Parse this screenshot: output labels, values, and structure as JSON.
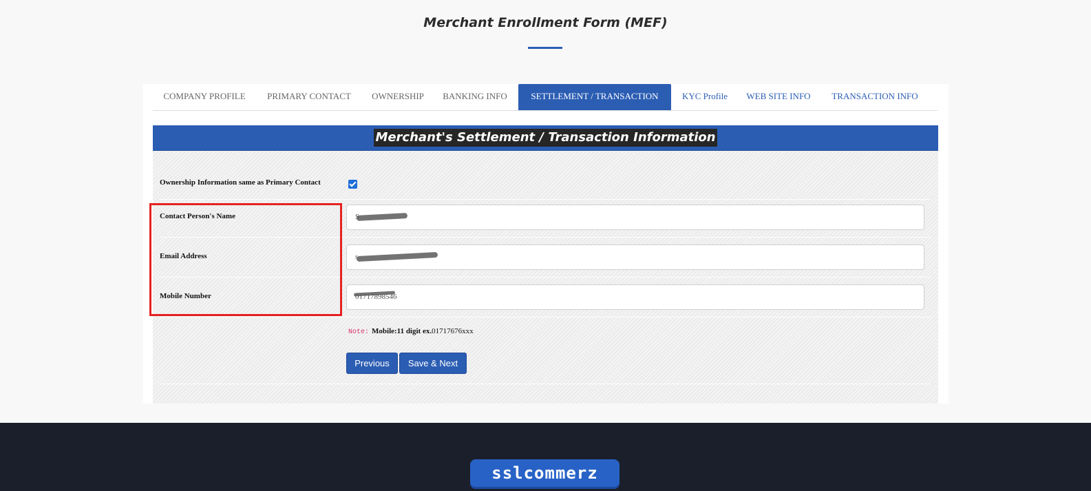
{
  "header": {
    "title": "Merchant Enrollment Form (MEF)"
  },
  "tabs": [
    {
      "label": "COMPANY PROFILE",
      "state": "done"
    },
    {
      "label": "PRIMARY CONTACT",
      "state": "done"
    },
    {
      "label": "OWNERSHIP",
      "state": "done"
    },
    {
      "label": "BANKING INFO",
      "state": "done"
    },
    {
      "label": "SETTLEMENT / TRANSACTION",
      "state": "active"
    },
    {
      "label": "KYC Profile",
      "state": "todo"
    },
    {
      "label": "WEB SITE INFO",
      "state": "todo"
    },
    {
      "label": "TRANSACTION INFO",
      "state": "todo"
    }
  ],
  "panel": {
    "title": "Merchant's Settlement / Transaction Information"
  },
  "form": {
    "same_as_primary_label": "Ownership Information same as Primary Contact",
    "same_as_primary_checked": true,
    "contact_name_label": "Contact Person's Name",
    "contact_name_value": "S",
    "email_label": "Email Address",
    "email_value": "s",
    "mobile_label": "Mobile Number",
    "mobile_value": "01717898546",
    "note_code": "Note:",
    "note_strong": "Mobile:11 digit ex.",
    "note_example": "01717676xxx"
  },
  "buttons": {
    "previous": "Previous",
    "save_next": "Save & Next"
  },
  "footer": {
    "logo_text": "sslcommerz"
  },
  "colors": {
    "primary": "#2b5db3",
    "highlight": "#e52121",
    "footer_bg": "#1b1f2b"
  }
}
